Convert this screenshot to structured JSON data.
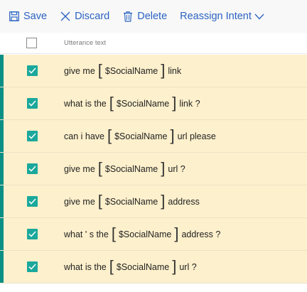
{
  "toolbar": {
    "save_label": "Save",
    "discard_label": "Discard",
    "delete_label": "Delete",
    "reassign_label": "Reassign Intent",
    "accent_color": "#2b63c2"
  },
  "header": {
    "column_label": "Utterance text"
  },
  "rows": [
    {
      "before": "give me",
      "entity": "$SocialName",
      "after": "link",
      "checked": true
    },
    {
      "before": "what is the",
      "entity": "$SocialName",
      "after": "link ?",
      "checked": true
    },
    {
      "before": "can i have",
      "entity": "$SocialName",
      "after": "url please",
      "checked": true
    },
    {
      "before": "give me",
      "entity": "$SocialName",
      "after": "url ?",
      "checked": true
    },
    {
      "before": "give me",
      "entity": "$SocialName",
      "after": "address",
      "checked": true
    },
    {
      "before": "what ' s the",
      "entity": "$SocialName",
      "after": "address ?",
      "checked": true
    },
    {
      "before": "what is the",
      "entity": "$SocialName",
      "after": "url ?",
      "checked": true
    }
  ],
  "colors": {
    "row_background": "#fdf0cc",
    "row_accent": "#0b8f85",
    "checkbox_checked": "#1aa89c"
  }
}
